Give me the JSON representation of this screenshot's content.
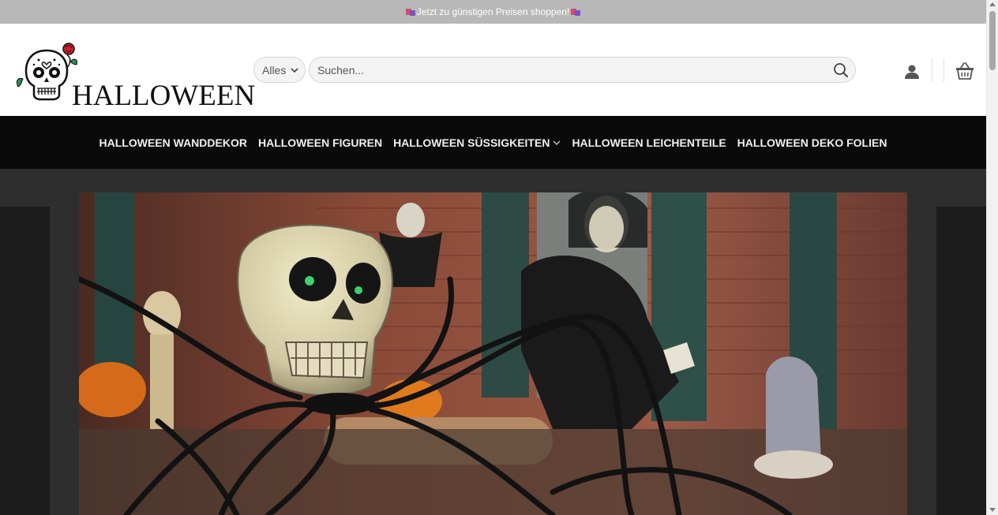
{
  "topbar": {
    "text": "Jetzt zu günstigen Preisen shoppen!"
  },
  "header": {
    "logo_text": "HALLOWEEN",
    "category_select": {
      "value": "Alles"
    },
    "search": {
      "placeholder": "Suchen..."
    }
  },
  "nav": {
    "items": [
      {
        "label": "HALLOWEEN WANDDEKOR"
      },
      {
        "label": "HALLOWEEN FIGUREN"
      },
      {
        "label": "HALLOWEEN SÜSSIGKEITEN",
        "has_dropdown": true
      },
      {
        "label": "HALLOWEEN LEICHENTEILE"
      },
      {
        "label": "HALLOWEEN DEKO FOLIEN"
      }
    ]
  },
  "icons": {
    "account": "user-icon",
    "cart": "basket-icon",
    "search": "search-icon"
  },
  "colors": {
    "topbar_bg": "#b8b8b8",
    "nav_bg": "#0a0a0a",
    "stage_bg": "#2e2e2e"
  }
}
